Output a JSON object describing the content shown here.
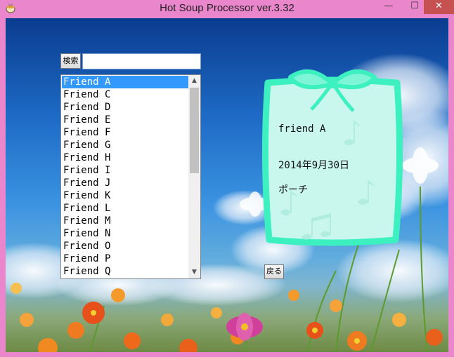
{
  "window": {
    "title": "Hot Soup Processor ver.3.32",
    "min_symbol": "—",
    "max_symbol": "☐",
    "close_symbol": "✕"
  },
  "search": {
    "button_label": "検索",
    "input_value": ""
  },
  "friend_list": {
    "items": [
      "Friend A",
      "Friend C",
      "Friend D",
      "Friend E",
      "Friend F",
      "Friend G",
      "Friend H",
      "Friend I",
      "Friend J",
      "Friend K",
      "Friend L",
      "Friend M",
      "Friend N",
      "Friend O",
      "Friend P",
      "Friend Q"
    ],
    "selected_index": 0,
    "scroll_up": "▲",
    "scroll_down": "▼"
  },
  "card": {
    "name": "friend A",
    "date": "2014年9月30日",
    "item": "ポーチ"
  },
  "back_button": {
    "label": "戻る"
  },
  "colors": {
    "window_frame": "#ea86cc",
    "card_fill": "#c9f7ee",
    "card_border": "#3cf0c0",
    "selection": "#3399ff"
  }
}
